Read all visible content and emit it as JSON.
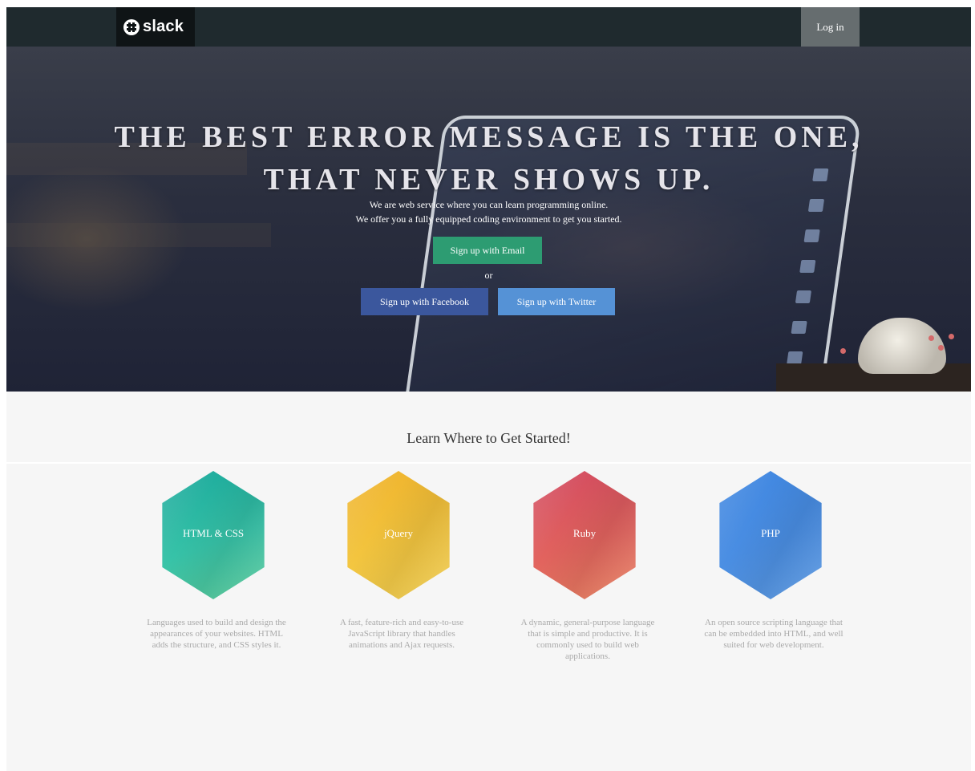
{
  "navbar": {
    "logo_text": "slack",
    "login_label": "Log in"
  },
  "hero": {
    "title_line1": "THE BEST ERROR MESSAGE IS THE ONE,",
    "title_line2": "THAT NEVER SHOWS UP.",
    "subtitle_line1": "We are web service where you can learn programming online.",
    "subtitle_line2": "We offer you a fully equipped coding environment to get you started.",
    "signup_email_label": "Sign up with Email",
    "or_label": "or",
    "signup_facebook_label": "Sign up with Facebook",
    "signup_twitter_label": "Sign up with Twitter"
  },
  "section": {
    "title": "Learn Where to Get Started!"
  },
  "cards": [
    {
      "label": "HTML & CSS",
      "description": "Languages used to build and design the appearances of your websites. HTML adds the structure, and CSS styles it.",
      "color": "#1fb0a0"
    },
    {
      "label": "jQuery",
      "description": "A fast, feature-rich and easy-to-use JavaScript library that handles animations and Ajax requests.",
      "color": "#f2be37"
    },
    {
      "label": "Ruby",
      "description": "A dynamic, general-purpose language that is simple and productive. It is commonly used to build web applications.",
      "color": "#dd5661"
    },
    {
      "label": "PHP",
      "description": "An open source scripting language that can be embedded into HTML, and well suited for web development.",
      "color": "#4a8ee3"
    }
  ],
  "colors": {
    "navbar_bg": "#1f2a2e",
    "email_button": "#2d9c72",
    "facebook_button": "#3b579d",
    "twitter_button": "#5592d6"
  },
  "icons": {
    "logo": "slack-logo-icon"
  }
}
